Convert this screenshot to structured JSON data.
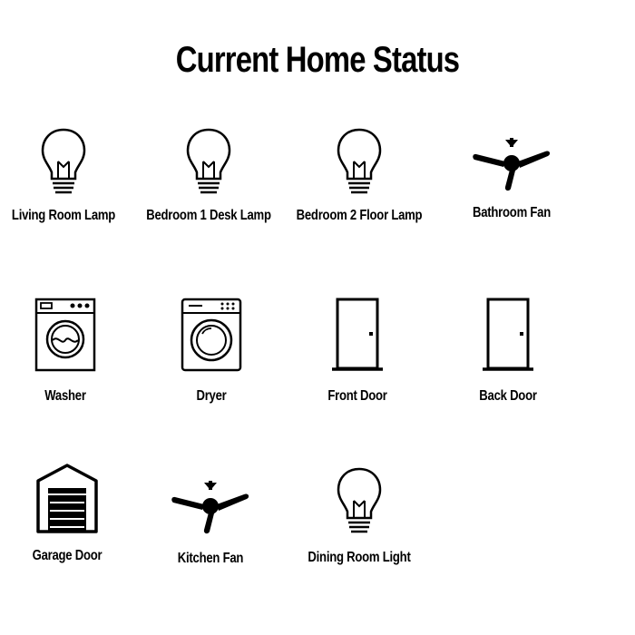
{
  "page": {
    "title": "Current Home Status"
  },
  "devices": [
    {
      "label": "Living Room Lamp",
      "icon": "light-bulb-icon"
    },
    {
      "label": "Bedroom 1 Desk Lamp",
      "icon": "light-bulb-icon"
    },
    {
      "label": "Bedroom 2 Floor Lamp",
      "icon": "light-bulb-icon"
    },
    {
      "label": "Bathroom Fan",
      "icon": "ceiling-fan-icon"
    },
    {
      "label": "Washer",
      "icon": "washing-machine-icon"
    },
    {
      "label": "Dryer",
      "icon": "dryer-icon"
    },
    {
      "label": "Front Door",
      "icon": "door-icon"
    },
    {
      "label": "Back Door",
      "icon": "door-icon"
    },
    {
      "label": "Garage Door",
      "icon": "garage-icon"
    },
    {
      "label": "Kitchen Fan",
      "icon": "ceiling-fan-icon"
    },
    {
      "label": "Dining Room Light",
      "icon": "light-bulb-icon"
    }
  ]
}
